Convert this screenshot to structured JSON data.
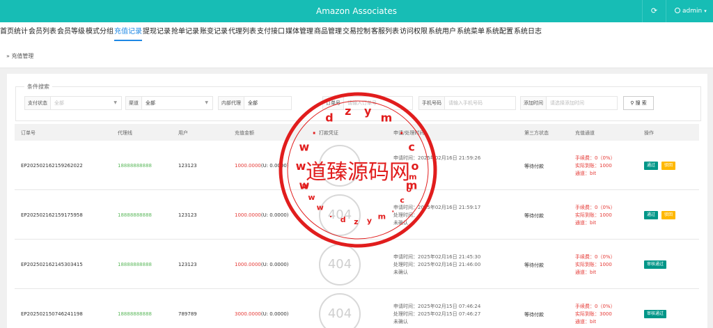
{
  "header": {
    "title": "Amazon Associates",
    "refresh_icon": "refresh-icon",
    "user_name": "admin"
  },
  "nav": {
    "items": [
      "首页统计",
      "会员列表",
      "会员等级",
      "模式分组",
      "充值记录",
      "提现记录",
      "抢单记录",
      "账变记录",
      "代理列表",
      "支付接口",
      "媒体管理",
      "商品管理",
      "交易控制",
      "客服列表",
      "访问权限",
      "系统用户",
      "系统菜单",
      "系统配置",
      "系统日志"
    ],
    "active_index": 4
  },
  "breadcrumb": "» 充值管理",
  "search": {
    "legend": "条件搜索",
    "pay_status": {
      "label": "支付状态",
      "value": "全部"
    },
    "channel": {
      "label": "渠道",
      "value": "全部"
    },
    "agent": {
      "label": "内部代理",
      "value": "全部"
    },
    "order_no": {
      "label": "订单号",
      "placeholder": "请输入订单号"
    },
    "phone": {
      "label": "手机号码",
      "placeholder": "请输入手机号码"
    },
    "add_time": {
      "label": "添加时间",
      "placeholder": "请选择添加时间"
    },
    "button": "搜 索"
  },
  "table": {
    "headers": [
      "订单号",
      "代理线",
      "用户",
      "充值金额",
      "打款凭证",
      "申请/处理时间",
      "第三方状态",
      "充值通道",
      "操作"
    ],
    "rows": [
      {
        "order": "EP202502162159262022",
        "agent": "18888888888",
        "user": "123123",
        "amount": "1000.0000",
        "amount_u": "(U: 0.0000)",
        "proof": "",
        "apply": "申请时间：2025年02月16日 21:59:26",
        "process": "",
        "confirm": "",
        "third": "等待付款",
        "fee": "手续费：0（0%）",
        "actual": "实际到账：1000",
        "channel": "通道：bit",
        "ops": [
          "通过",
          "驳回"
        ]
      },
      {
        "order": "EP202502162159175958",
        "agent": "18888888888",
        "user": "123123",
        "amount": "1000.0000",
        "amount_u": "(U: 0.0000)",
        "proof": "404",
        "apply": "申请时间：2025年02月16日 21:59:17",
        "process": "处理时间：",
        "confirm": "未确认",
        "third": "等待付款",
        "fee": "手续费：0（0%）",
        "actual": "实际到账：1000",
        "channel": "通道：bit",
        "ops": [
          "通过",
          "驳回"
        ]
      },
      {
        "order": "EP202502162145303415",
        "agent": "18888888888",
        "user": "123123",
        "amount": "1000.0000",
        "amount_u": "(U: 0.0000)",
        "proof": "404",
        "apply": "申请时间：2025年02月16日 21:45:30",
        "process": "处理时间：2025年02月16日 21:46:00",
        "confirm": "未确认",
        "third": "等待付款",
        "fee": "手续费：0（0%）",
        "actual": "实际到账：1000",
        "channel": "通道：bit",
        "ops": [
          "审核通过"
        ]
      },
      {
        "order": "EP202502150746241198",
        "agent": "18888888888",
        "user": "789789",
        "amount": "3000.0000",
        "amount_u": "(U: 0.0000)",
        "proof": "404",
        "apply": "申请时间：2025年02月15日 07:46:24",
        "process": "处理时间：2025年02月15日 07:46:27",
        "confirm": "未确认",
        "third": "等待付款",
        "fee": "手续费：0（0%）",
        "actual": "实际到账：3000",
        "channel": "通道：bit",
        "ops": [
          "审核通过"
        ]
      }
    ]
  },
  "watermark": {
    "text": "道臻源码网",
    "ring": "www.dzym.com"
  },
  "colors": {
    "header": "#17bdb5",
    "active": "#1e88e5",
    "agent": "#5cb85c",
    "money": "#e53935",
    "btn_green": "#009688",
    "btn_orange": "#ffb800",
    "stamp": "#e11d1d"
  }
}
